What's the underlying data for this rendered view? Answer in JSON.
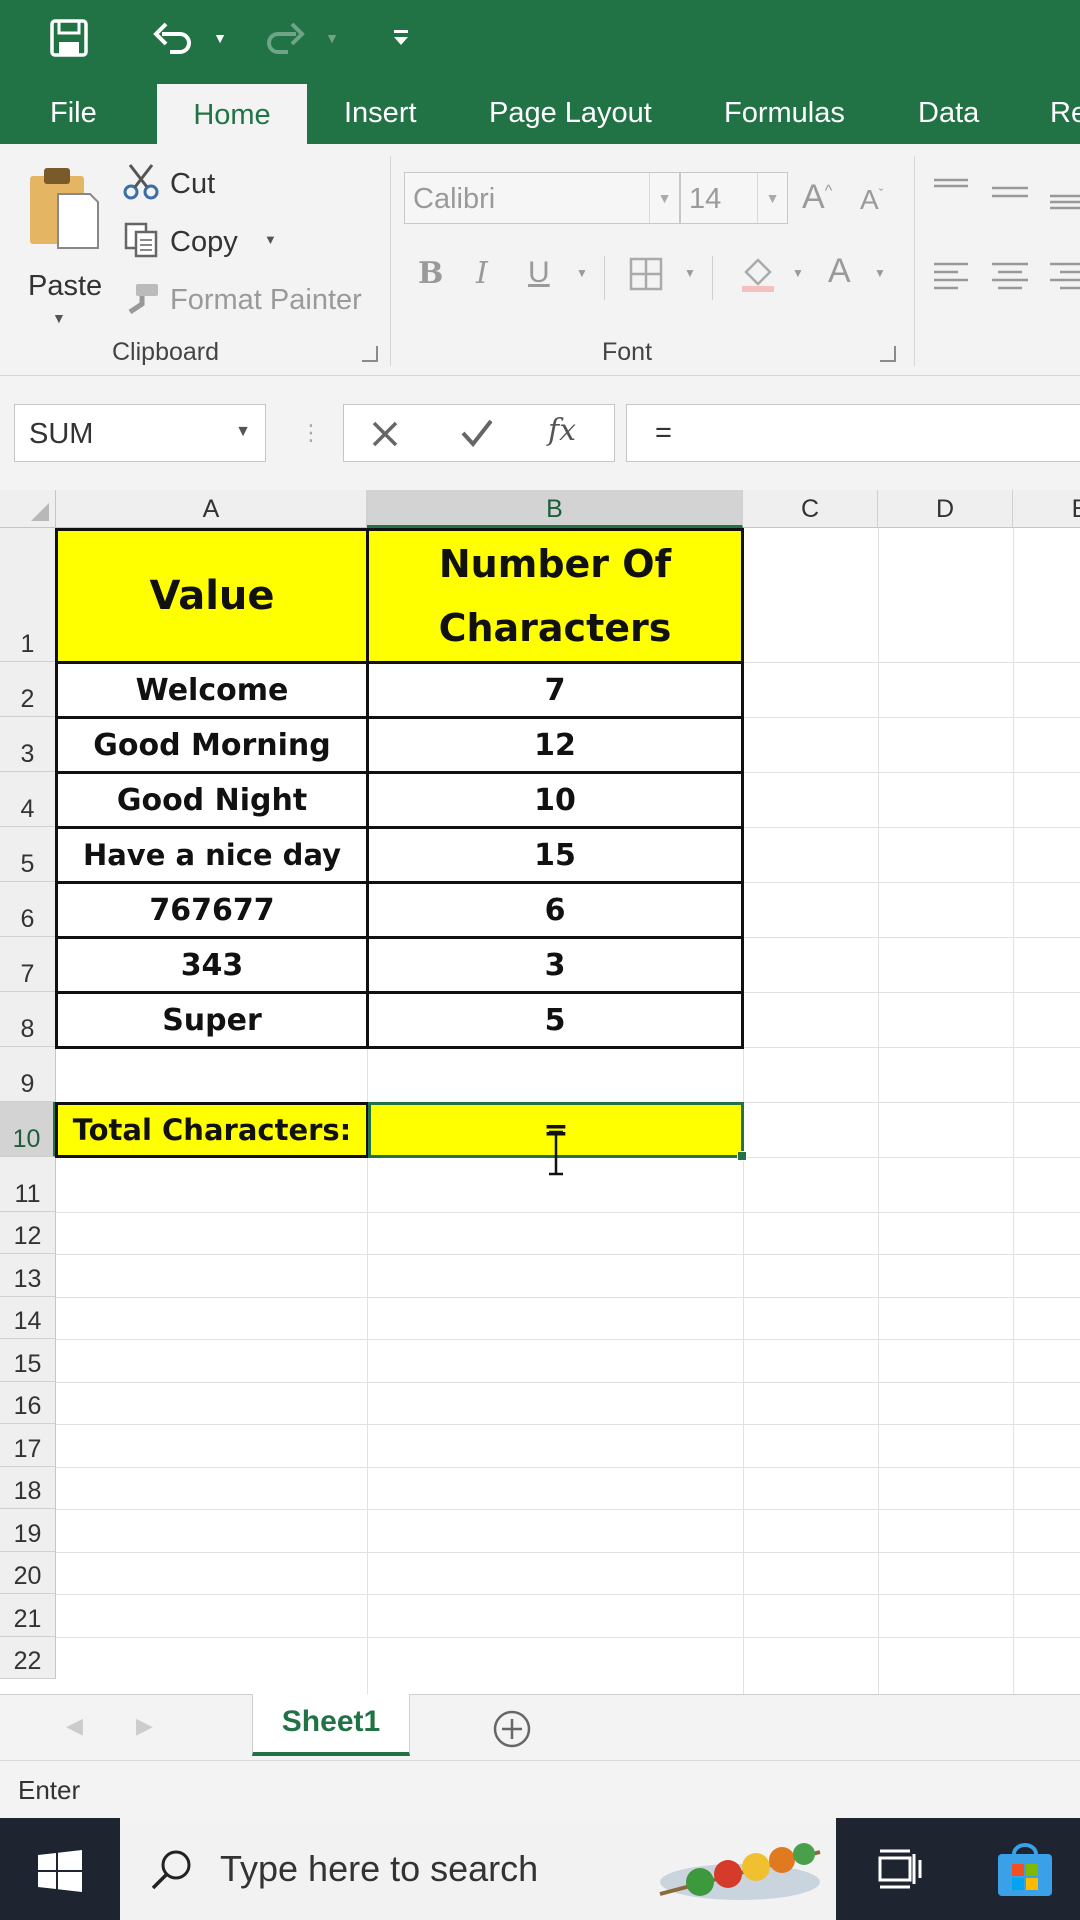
{
  "ribbon_tabs": [
    "File",
    "Home",
    "Insert",
    "Page Layout",
    "Formulas",
    "Data",
    "Re"
  ],
  "active_tab": "Home",
  "clipboard": {
    "paste_label": "Paste",
    "cut_label": "Cut",
    "copy_label": "Copy",
    "format_painter_label": "Format Painter",
    "group_label": "Clipboard"
  },
  "font": {
    "font_name": "Calibri",
    "font_size": "14",
    "group_label": "Font"
  },
  "formula_bar": {
    "name_box": "SUM",
    "fx_label": "fx",
    "content": "="
  },
  "columns": [
    "A",
    "B",
    "C",
    "D",
    "E"
  ],
  "rows": [
    "1",
    "2",
    "3",
    "4",
    "5",
    "6",
    "7",
    "8",
    "9",
    "10",
    "11",
    "12",
    "13",
    "14",
    "15",
    "16",
    "17",
    "18",
    "19",
    "20",
    "21",
    "22"
  ],
  "table": {
    "header_value": "Value",
    "header_count_line1": "Number Of",
    "header_count_line2": "Characters",
    "rows": [
      {
        "value": "Welcome",
        "count": "7"
      },
      {
        "value": "Good Morning",
        "count": "12"
      },
      {
        "value": "Good Night",
        "count": "10"
      },
      {
        "value": "Have a nice day",
        "count": "15"
      },
      {
        "value": "767677",
        "count": "6"
      },
      {
        "value": "343",
        "count": "3"
      },
      {
        "value": "Super",
        "count": "5"
      }
    ],
    "total_label": "Total Characters:",
    "total_value": "="
  },
  "sheet_tab": "Sheet1",
  "status": "Enter",
  "taskbar": {
    "search_placeholder": "Type here to search"
  },
  "colors": {
    "excel_green": "#217346",
    "highlight_yellow": "#ffff00",
    "taskbar": "#1f2530"
  },
  "icons": [
    "save-icon",
    "undo-icon",
    "redo-icon",
    "customize-qat-icon",
    "paste-icon",
    "cut-icon",
    "copy-icon",
    "format-painter-icon",
    "cancel-icon",
    "enter-icon",
    "fx-icon",
    "add-sheet-icon",
    "windows-start-icon",
    "search-icon",
    "task-view-icon",
    "store-icon"
  ]
}
